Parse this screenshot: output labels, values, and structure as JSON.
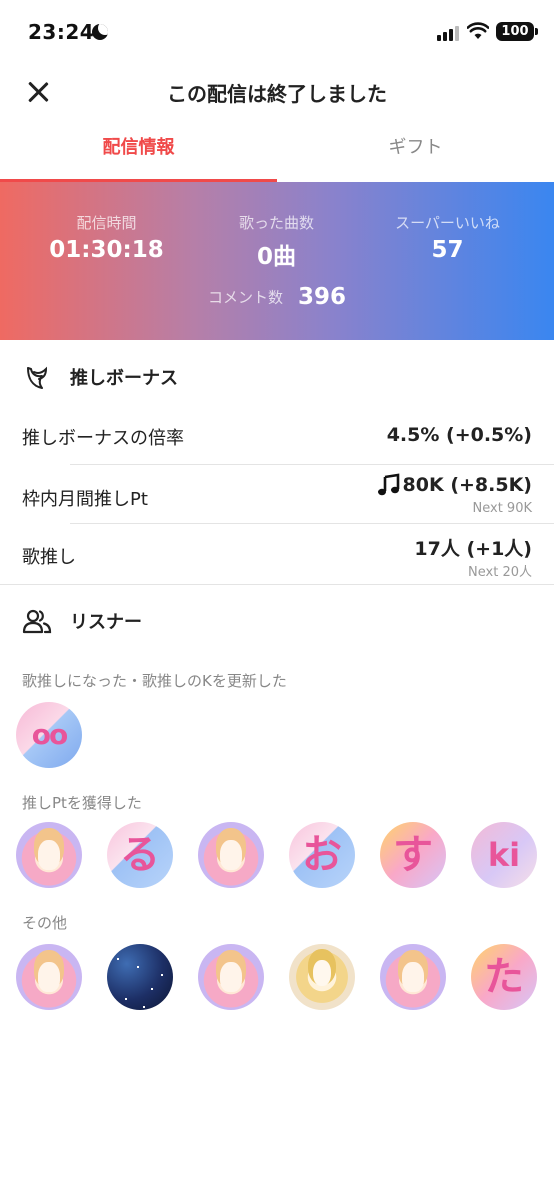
{
  "status_bar": {
    "time": "23:24",
    "battery": "100"
  },
  "header": {
    "title": "この配信は終了しました"
  },
  "tabs": [
    {
      "label": "配信情報",
      "active": true
    },
    {
      "label": "ギフト",
      "active": false
    }
  ],
  "stats": {
    "duration_label": "配信時間",
    "duration_value": "01:30:18",
    "songs_label": "歌った曲数",
    "songs_value": "0曲",
    "superlike_label": "スーパーいいね",
    "superlike_value": "57",
    "comments_label": "コメント数",
    "comments_value": "396"
  },
  "bonus": {
    "section_title": "推しボーナス",
    "rows": [
      {
        "label": "推しボーナスの倍率",
        "value": "4.5% (+0.5%)",
        "sub": ""
      },
      {
        "label": "枠内月間推しPt",
        "value": "80K (+8.5K)",
        "sub": "Next 90K"
      },
      {
        "label": "歌推し",
        "value": "17人 (+1人)",
        "sub": "Next 20人"
      }
    ]
  },
  "listeners": {
    "section_title": "リスナー",
    "groups": [
      {
        "label": "歌推しになった・歌推しのKを更新した",
        "avatars": [
          {
            "glyph": "oo",
            "style": "av-oo"
          }
        ]
      },
      {
        "label": "推しPtを獲得した",
        "avatars": [
          {
            "glyph": "",
            "style": "av-pastel"
          },
          {
            "glyph": "る",
            "style": "av-blue"
          },
          {
            "glyph": "",
            "style": "av-pastel"
          },
          {
            "glyph": "お",
            "style": "av-blue"
          },
          {
            "glyph": "す",
            "style": "av-yellow"
          },
          {
            "glyph": "ki",
            "style": "av-purple"
          }
        ]
      },
      {
        "label": "その他",
        "avatars": [
          {
            "glyph": "",
            "style": "av-pastel"
          },
          {
            "glyph": "",
            "style": "av-night"
          },
          {
            "glyph": "",
            "style": "av-pastel"
          },
          {
            "glyph": "",
            "style": "av-gold"
          },
          {
            "glyph": "",
            "style": "av-pastel"
          },
          {
            "glyph": "た",
            "style": "av-yellow"
          }
        ]
      }
    ]
  },
  "colors": {
    "accent": "#f04a4a",
    "gradient_start": "#ef6a62",
    "gradient_end": "#3a86f0"
  },
  "icons": [
    "moon-icon",
    "signal-icon",
    "wifi-icon",
    "battery-icon",
    "close-icon",
    "wing-icon",
    "music-note-icon",
    "people-icon"
  ]
}
